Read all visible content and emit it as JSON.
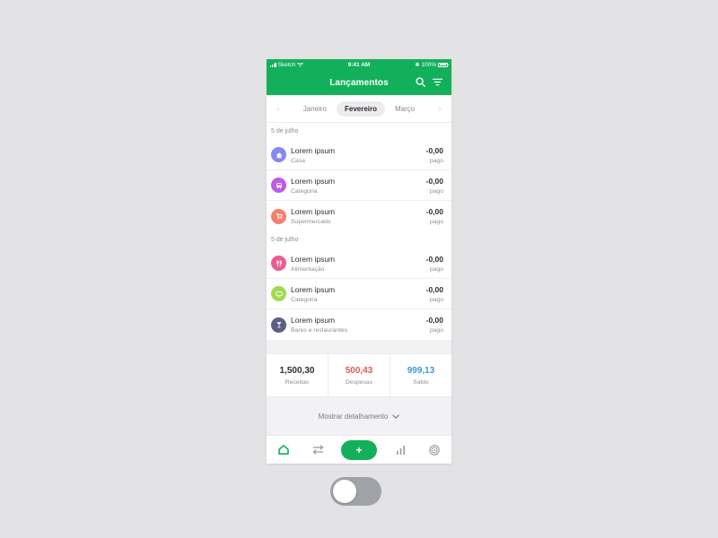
{
  "status_bar": {
    "carrier": "Sketch",
    "time": "9:41 AM",
    "battery": "100%"
  },
  "header": {
    "title": "Lançamentos"
  },
  "months": {
    "prev": "Janeiro",
    "current": "Fevereiro",
    "next": "Março"
  },
  "sections": [
    {
      "date": "5 de julho",
      "items": [
        {
          "title": "Lorem ipsum",
          "category": "Casa",
          "amount": "-0,00",
          "status": "pago",
          "icon": "home-icon",
          "color": "#8589f0"
        },
        {
          "title": "Lorem ipsum",
          "category": "Categoria",
          "amount": "-0,00",
          "status": "pago",
          "icon": "bus-icon",
          "color": "#c05be0"
        },
        {
          "title": "Lorem ipsum",
          "category": "Supermercado",
          "amount": "-0,00",
          "status": "pago",
          "icon": "cart-icon",
          "color": "#f3806c"
        }
      ]
    },
    {
      "date": "5 de julho",
      "items": [
        {
          "title": "Lorem ipsum",
          "category": "Alimentação",
          "amount": "-0,00",
          "status": "pago",
          "icon": "fork-knife-icon",
          "color": "#eb5c96"
        },
        {
          "title": "Lorem ipsum",
          "category": "Categoria",
          "amount": "-0,00",
          "status": "pago",
          "icon": "monitor-icon",
          "color": "#a2d94e"
        },
        {
          "title": "Lorem ipsum",
          "category": "Bares e restaurantes",
          "amount": "-0,00",
          "status": "pago",
          "icon": "cocktail-icon",
          "color": "#5b5f85"
        }
      ]
    }
  ],
  "summary": [
    {
      "value": "1,500,30",
      "label": "Receitas",
      "color": "#2e2e33"
    },
    {
      "value": "500,43",
      "label": "Despesas",
      "color": "#e05a4f"
    },
    {
      "value": "999,13",
      "label": "Saldo",
      "color": "#3b9ad9"
    }
  ],
  "details_label": "Mostrar detalhamento",
  "tabs": {
    "add_label": "+"
  },
  "colors": {
    "brand": "#12b05b"
  }
}
